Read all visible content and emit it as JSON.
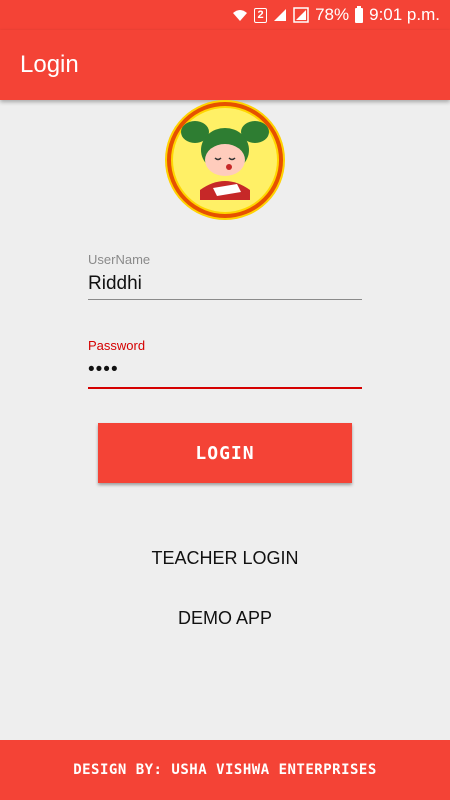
{
  "status_bar": {
    "wifi_icon": "wifi-icon",
    "sim_label": "2",
    "signal_icon": "signal-icon",
    "battery_percent": "78%",
    "time": "9:01 p.m."
  },
  "app_bar": {
    "title": "Login"
  },
  "logo": {
    "icon": "girl-reading-logo"
  },
  "form": {
    "username": {
      "label": "UserName",
      "value": "Riddhi"
    },
    "password": {
      "label": "Password",
      "value": "••••"
    }
  },
  "login_button": {
    "label": "LOGIN"
  },
  "links": {
    "teacher_login": "TEACHER LOGIN",
    "demo_app": "DEMO APP"
  },
  "footer": {
    "text": "DESIGN BY: USHA VISHWA ENTERPRISES"
  },
  "colors": {
    "primary": "#f44336",
    "accent": "#d50000",
    "background": "#eeeeee"
  }
}
